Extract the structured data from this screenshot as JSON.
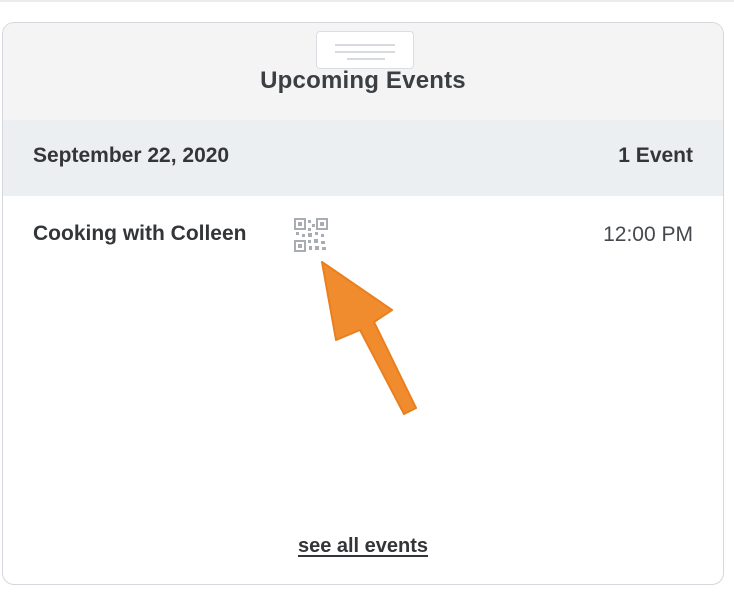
{
  "widget": {
    "title": "Upcoming Events"
  },
  "day": {
    "date": "September 22, 2020",
    "count_label": "1 Event"
  },
  "events": [
    {
      "name": "Cooking with Colleen",
      "time": "12:00 PM",
      "icon": "qr-code-icon"
    }
  ],
  "footer": {
    "link_label": "see all events"
  },
  "annotation": {
    "icon": "arrow-pointer-icon",
    "color": "#f08c2e"
  }
}
